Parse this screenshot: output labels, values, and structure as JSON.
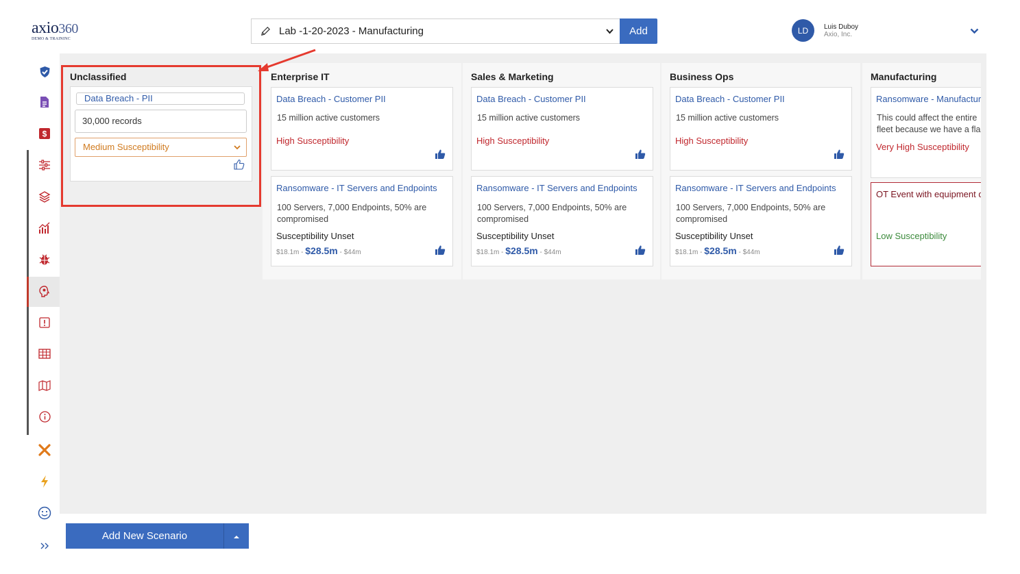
{
  "logo": {
    "brand": "axio",
    "brand_num": "360",
    "subtitle": "DEMO & TRAININC"
  },
  "header": {
    "scenario_name": "Lab -1-20-2023 - Manufacturing",
    "add_label": "Add",
    "user": {
      "initials": "LD",
      "name": "Luis Duboy",
      "org": "Axio, Inc."
    }
  },
  "sidebar": {
    "icons": [
      "shield-check-icon",
      "document-icon",
      "dollar-icon",
      "sliders-icon",
      "layers-icon",
      "chart-icon",
      "bug-icon",
      "brain-icon",
      "alert-icon",
      "table-icon",
      "map-icon",
      "info-icon",
      "tools-icon",
      "bolt-icon",
      "smiley-icon",
      "expand-icon"
    ],
    "active": "brain-icon"
  },
  "columns": [
    {
      "title": "Unclassified",
      "card": {
        "title": "Data Breach - PII",
        "description": "30,000 records",
        "susceptibility": "Medium Susceptibility"
      }
    },
    {
      "title": "Enterprise IT",
      "cards": [
        {
          "title": "Data Breach - Customer PII",
          "description": "15 million active customers",
          "susceptibility": "High Susceptibility"
        },
        {
          "title": "Ransomware - IT Servers and Endpoints",
          "description": "100 Servers, 7,000 Endpoints, 50% are compromised",
          "susceptibility": "Susceptibility Unset",
          "range_low": "$18.1m",
          "range_mid": "$28.5m",
          "range_high": "$44m"
        }
      ]
    },
    {
      "title": "Sales & Marketing",
      "cards": [
        {
          "title": "Data Breach - Customer PII",
          "description": "15 million active customers",
          "susceptibility": "High Susceptibility"
        },
        {
          "title": "Ransomware - IT Servers and Endpoints",
          "description": "100 Servers, 7,000 Endpoints, 50% are compromised",
          "susceptibility": "Susceptibility Unset",
          "range_low": "$18.1m",
          "range_mid": "$28.5m",
          "range_high": "$44m"
        }
      ]
    },
    {
      "title": "Business Ops",
      "cards": [
        {
          "title": "Data Breach - Customer PII",
          "description": "15 million active customers",
          "susceptibility": "High Susceptibility"
        },
        {
          "title": "Ransomware - IT Servers and Endpoints",
          "description": "100 Servers, 7,000 Endpoints, 50% are compromised",
          "susceptibility": "Susceptibility Unset",
          "range_low": "$18.1m",
          "range_mid": "$28.5m",
          "range_high": "$44m"
        }
      ]
    },
    {
      "title": "Manufacturing",
      "cards": [
        {
          "title": "Ransomware - Manufacturi",
          "description": "This could affect the entire fleet because we have a fla",
          "susceptibility": "Very High Susceptibility"
        },
        {
          "title": "OT Event with equipment d",
          "susceptibility": "Low Susceptibility"
        }
      ]
    }
  ],
  "footer": {
    "add_scenario_label": "Add New Scenario"
  },
  "colors": {
    "accent": "#3a6bbf",
    "high": "#c0272d",
    "medium": "#d07a1e",
    "low": "#3b8a3b",
    "highlight": "#e53a2f"
  }
}
